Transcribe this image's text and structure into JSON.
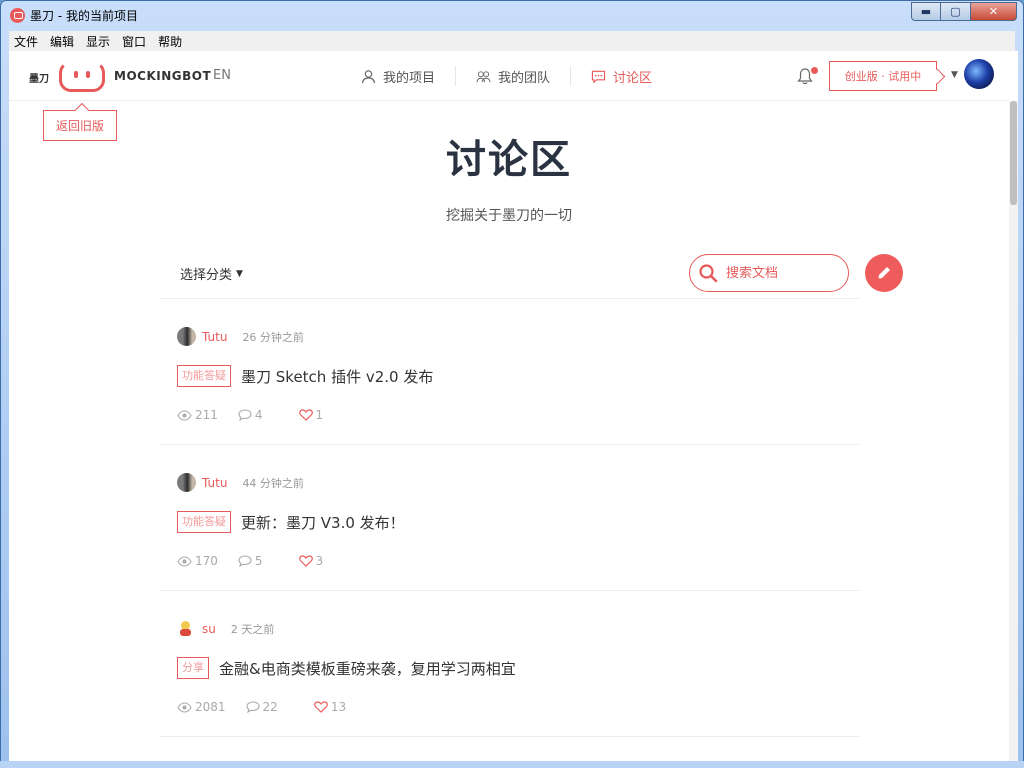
{
  "window": {
    "title": "墨刀 - 我的当前项目",
    "min_glyph": "▬",
    "max_glyph": "▢",
    "close_glyph": "✕"
  },
  "menu": [
    "文件",
    "编辑",
    "显示",
    "窗口",
    "帮助"
  ],
  "header": {
    "logo_cn": "墨刀",
    "logo_text": "MOCKINGBOT",
    "lang": "EN",
    "nav": [
      {
        "label": "我的项目",
        "icon": "user-icon"
      },
      {
        "label": "我的团队",
        "icon": "team-icon"
      },
      {
        "label": "讨论区",
        "icon": "chat-icon",
        "active": true
      }
    ],
    "plan": "创业版 · 试用中",
    "dropdown": "▼"
  },
  "back_button": "返回旧版",
  "page": {
    "title": "讨论区",
    "subtitle": "挖掘关于墨刀的一切"
  },
  "filter": {
    "label": "选择分类",
    "caret": "▼"
  },
  "search": {
    "placeholder": "搜索文档"
  },
  "posts": [
    {
      "author": "Tutu",
      "avatar": "tutu",
      "time": "26 分钟之前",
      "tag": "功能答疑",
      "title": "墨刀 Sketch 插件 v2.0 发布",
      "views": "211",
      "comments": "4",
      "likes": "1"
    },
    {
      "author": "Tutu",
      "avatar": "tutu",
      "time": "44 分钟之前",
      "tag": "功能答疑",
      "title": "更新：墨刀 V3.0 发布！",
      "views": "170",
      "comments": "5",
      "likes": "3"
    },
    {
      "author": "su",
      "avatar": "su",
      "time": "2 天之前",
      "tag": "分享",
      "title": "金融&电商类模板重磅来袭，复用学习两相宜",
      "views": "2081",
      "comments": "22",
      "likes": "13"
    }
  ],
  "colors": {
    "accent": "#e85a5a",
    "title": "#2b3342"
  }
}
